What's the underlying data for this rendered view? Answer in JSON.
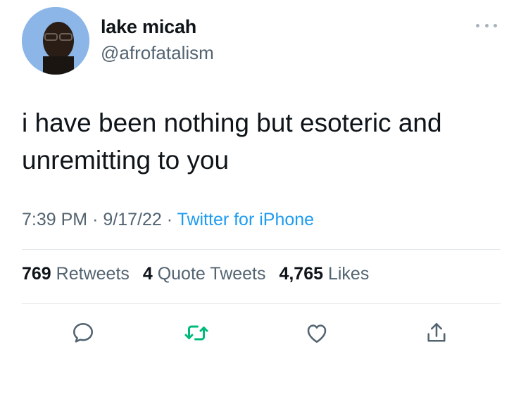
{
  "author": {
    "display_name": "lake micah",
    "handle": "@afrofatalism"
  },
  "tweet": {
    "text": "i have been nothing but esoteric and unremitting to you",
    "time": "7:39 PM",
    "separator": "·",
    "date": "9/17/22",
    "source": "Twitter for iPhone"
  },
  "stats": {
    "retweets_count": "769",
    "retweets_label": "Retweets",
    "quotes_count": "4",
    "quotes_label": "Quote Tweets",
    "likes_count": "4,765",
    "likes_label": "Likes"
  },
  "icons": {
    "more": "more-dots-icon",
    "reply": "reply-icon",
    "retweet": "retweet-icon",
    "like": "heart-icon",
    "share": "share-icon"
  },
  "colors": {
    "text": "#0f1419",
    "secondary": "#536471",
    "link": "#1d9bf0",
    "retweet_active": "#00ba7c",
    "divider": "#e6e9eb"
  }
}
